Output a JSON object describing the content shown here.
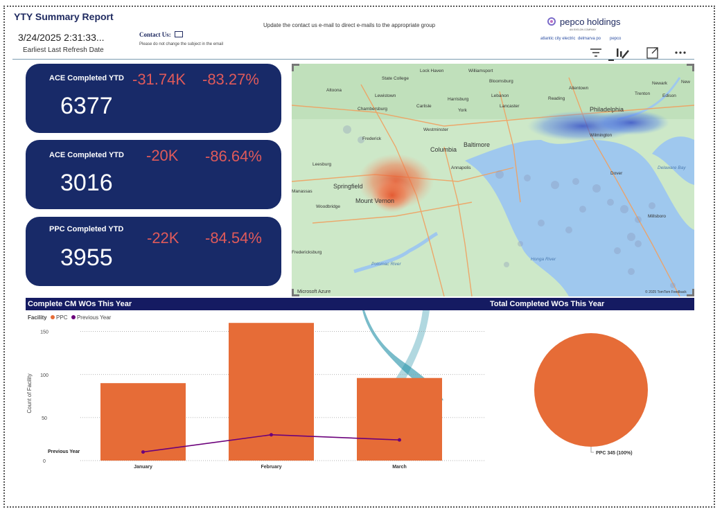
{
  "header": {
    "title": "YTY Summary Report",
    "refresh_timestamp": "3/24/2025 2:31:33...",
    "refresh_label": "Earliest Last Refresh Date",
    "contact_label": "Contact Us:",
    "contact_note": "Please do not change the subject in the email",
    "notice": "Update the contact us e-mail to direct e-mails to the appropriate group"
  },
  "logo": {
    "brand": "pepco holdings",
    "tagline": "AN EXELON COMPANY",
    "sub1": "atlantic city electric",
    "sub2": "delmarva po",
    "sub3": "pepco"
  },
  "toolbar": {
    "icons": [
      "filter-icon",
      "visual-format-icon",
      "focus-mode-icon",
      "more-options-icon"
    ]
  },
  "cards": [
    {
      "title": "ACE Completed YTD",
      "value": "6377",
      "delta_abs": "-31.74K",
      "delta_pct": "-83.27%"
    },
    {
      "title": "ACE Completed YTD",
      "value": "3016",
      "delta_abs": "-20K",
      "delta_pct": "-86.64%"
    },
    {
      "title": "PPC Completed YTD",
      "value": "3955",
      "delta_abs": "-22K",
      "delta_pct": "-84.54%"
    }
  ],
  "map": {
    "labels": [
      "Lock Haven",
      "Williamsport",
      "Bloomsburg",
      "Allentown",
      "Newark",
      "New",
      "State College",
      "Lewistown",
      "Harrisburg",
      "Lebanon",
      "Reading",
      "Trenton",
      "Altoona",
      "Chambersburg",
      "Carlisle",
      "York",
      "Lancaster",
      "Philadelphia",
      "Edison",
      "Westminster",
      "Wilmington",
      "Frederick",
      "Columbia",
      "Baltimore",
      "Leesburg",
      "Annapolis",
      "Dover",
      "Delaware Bay",
      "Springfield",
      "Mount Vernon",
      "Woodbridge",
      "Millsboro",
      "Manassas",
      "Potomac River",
      "Honga River",
      "Fredericksburg"
    ],
    "attribution_left": "Microsoft Azure",
    "attribution_right": "© 2025 TomTom  Feedback"
  },
  "sections": {
    "left_title": "Complete CM WOs This Year",
    "right_title": "Total Completed WOs This Year"
  },
  "legend": {
    "field": "Facility",
    "items": [
      {
        "label": "PPC",
        "color": "#e66c37"
      },
      {
        "label": "Previous Year",
        "color": "#6b007b"
      }
    ]
  },
  "chart_data": [
    {
      "type": "bar",
      "title": "Complete CM WOs This Year",
      "categories": [
        "January",
        "February",
        "March"
      ],
      "series": [
        {
          "name": "PPC",
          "values": [
            90,
            160,
            96
          ],
          "color": "#e66c37"
        },
        {
          "name": "Previous Year",
          "values": [
            10,
            30,
            24
          ],
          "color": "#6b007b",
          "kind": "line"
        }
      ],
      "ylabel": "Count of Facility",
      "yticks": [
        0,
        50,
        100,
        150
      ],
      "ylim": [
        0,
        165
      ],
      "line_label": "Previous Year"
    },
    {
      "type": "pie",
      "title": "Total Completed WOs This Year",
      "slices": [
        {
          "name": "PPC",
          "value": 345,
          "label": "PPC 345 (100%)",
          "color": "#e66c37"
        }
      ]
    }
  ]
}
